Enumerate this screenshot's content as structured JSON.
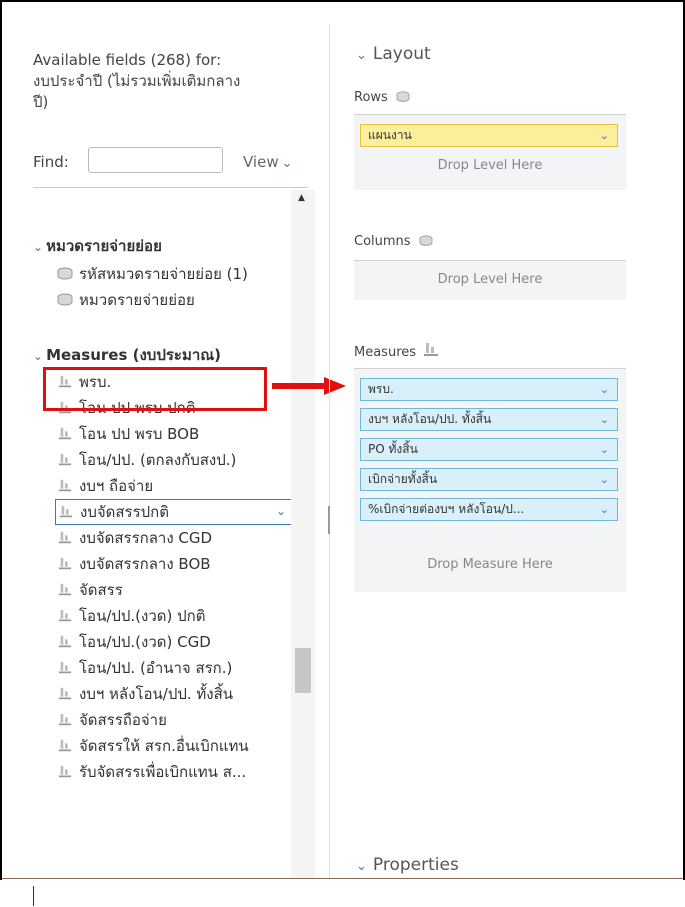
{
  "left": {
    "available_line1": "Available fields (268) for:",
    "available_line2": "งบประจำปี (ไม่รวมเพิ่มเติมกลาง",
    "available_line3": "ปี)",
    "find_label": "Find:",
    "find_value": "",
    "view_label": "View",
    "groups": [
      {
        "label": "หมวดรายจ่ายย่อย",
        "items": [
          "รหัสหมวดรายจ่ายย่อย (1)",
          "หมวดรายจ่ายย่อย"
        ]
      },
      {
        "label": "Measures (งบประมาณ)",
        "items": [
          "พรบ.",
          "โอน ปป พรบ ปกติ",
          "โอน ปป พรบ BOB",
          "โอน/ปป. (ตกลงกับสงป.)",
          "งบฯ ถือจ่าย",
          "งบจัดสรรปกติ",
          "งบจัดสรรกลาง CGD",
          "งบจัดสรรกลาง BOB",
          "จัดสรร",
          "โอน/ปป.(งวด) ปกติ",
          "โอน/ปป.(งวด) CGD",
          "โอน/ปป. (อำนาจ สรก.)",
          "งบฯ หลังโอน/ปป. ทั้งสิ้น",
          "จัดสรรถือจ่าย",
          "จัดสรรให้ สรก.อื่นเบิกแทน",
          "รับจัดสรรเพื่อเบิกแทน ส..."
        ]
      }
    ],
    "selected_item": "งบจัดสรรปกติ",
    "highlighted_item": "พรบ."
  },
  "layout": {
    "title": "Layout",
    "rows_label": "Rows",
    "rows_pills": [
      "แผนงาน"
    ],
    "rows_drop": "Drop Level Here",
    "columns_label": "Columns",
    "columns_drop": "Drop Level Here",
    "measures_label": "Measures",
    "measures_pills": [
      "พรบ.",
      "งบฯ หลังโอน/ปป. ทั้งสิ้น",
      "PO ทั้งสิ้น",
      "เบิกจ่ายทั้งสิ้น",
      "%เบิกจ่ายต่องบฯ หลังโอน/ป..."
    ],
    "measures_drop": "Drop Measure Here"
  },
  "properties": {
    "title": "Properties"
  },
  "colors": {
    "accent": "#3a78c2",
    "highlight_red": "#e01010",
    "pill_blue": "#d9f0fb",
    "pill_yellow": "#fbef9c"
  }
}
